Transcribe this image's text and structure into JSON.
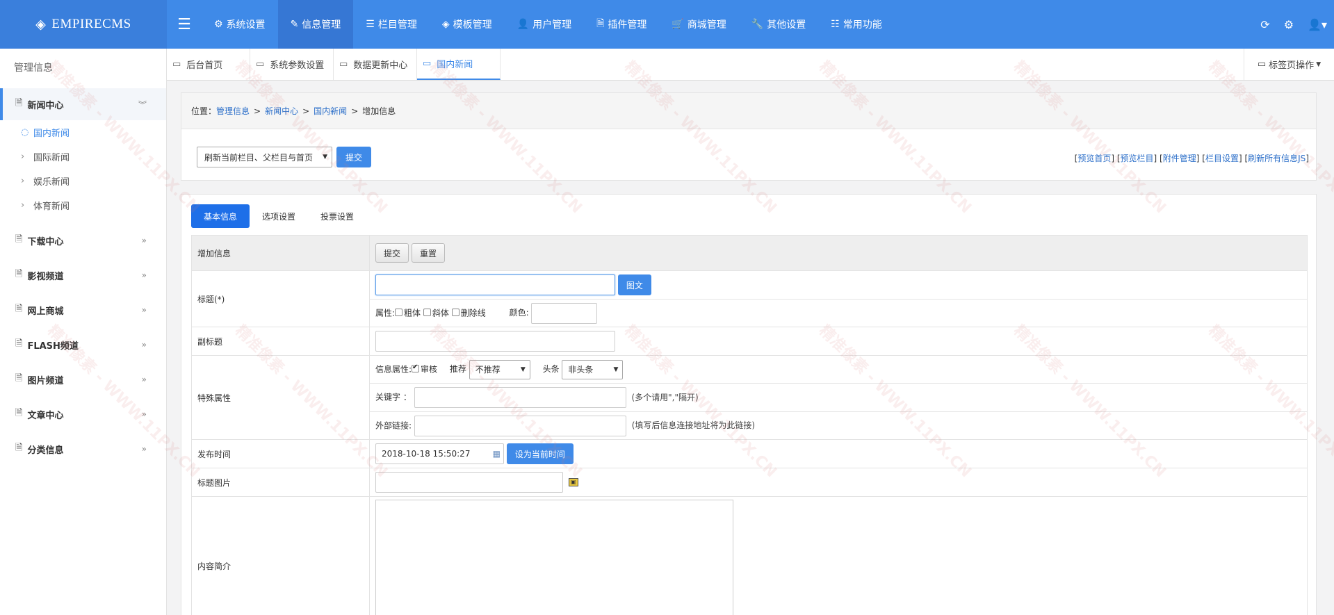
{
  "app": {
    "logo_text": "EMPIRECMS"
  },
  "topnav": [
    {
      "label": "系统设置",
      "icon": "gear-icon"
    },
    {
      "label": "信息管理",
      "icon": "edit-icon",
      "active": true
    },
    {
      "label": "栏目管理",
      "icon": "list-icon"
    },
    {
      "label": "模板管理",
      "icon": "layers-icon"
    },
    {
      "label": "用户管理",
      "icon": "user-icon"
    },
    {
      "label": "插件管理",
      "icon": "file-code-icon"
    },
    {
      "label": "商城管理",
      "icon": "cart-icon"
    },
    {
      "label": "其他设置",
      "icon": "wrench-icon"
    },
    {
      "label": "常用功能",
      "icon": "sliders-icon"
    }
  ],
  "sidebar": {
    "title": "管理信息",
    "groups": [
      {
        "label": "新闻中心",
        "open": true,
        "items": [
          {
            "label": "国内新闻",
            "active": true
          },
          {
            "label": "国际新闻"
          },
          {
            "label": "娱乐新闻"
          },
          {
            "label": "体育新闻"
          }
        ]
      },
      {
        "label": "下载中心"
      },
      {
        "label": "影视频道"
      },
      {
        "label": "网上商城"
      },
      {
        "label": "FLASH频道"
      },
      {
        "label": "图片频道"
      },
      {
        "label": "文章中心"
      },
      {
        "label": "分类信息"
      }
    ]
  },
  "pagetabs": [
    {
      "label": "后台首页"
    },
    {
      "label": "系统参数设置"
    },
    {
      "label": "数据更新中心"
    },
    {
      "label": "国内新闻",
      "active": true
    }
  ],
  "tab_ops_label": "标签页操作",
  "breadcrumb": {
    "prefix": "位置：",
    "links": [
      "管理信息",
      "新闻中心",
      "国内新闻"
    ],
    "current": "增加信息",
    "sep": ">"
  },
  "refresh": {
    "selected": "刷新当前栏目、父栏目与首页",
    "submit": "提交"
  },
  "quicklinks": [
    "预览首页",
    "预览栏目",
    "附件管理",
    "栏目设置",
    "刷新所有信息JS"
  ],
  "formtabs": [
    {
      "label": "基本信息",
      "active": true
    },
    {
      "label": "选项设置"
    },
    {
      "label": "投票设置"
    }
  ],
  "form": {
    "header_label": "增加信息",
    "submit": "提交",
    "reset": "重置",
    "title_label": "标题(*)",
    "title_btn": "图文",
    "attr_label": "属性:",
    "attr_bold": "粗体",
    "attr_italic": "斜体",
    "attr_strike": "删除线",
    "color_label": "颜色:",
    "subtitle_label": "副标题",
    "special_label": "特殊属性",
    "info_attr_label": "信息属性:",
    "review_label": "审核",
    "recommend_label": "推荐",
    "recommend_value": "不推荐",
    "headline_label": "头条",
    "headline_value": "非头条",
    "keyword_label": "关键字 ：",
    "keyword_hint": "(多个请用\",\"隔开)",
    "extlink_label": "外部链接:",
    "extlink_hint": "(填写后信息连接地址将为此链接)",
    "pubtime_label": "发布时间",
    "pubtime_value": "2018-10-18 15:50:27",
    "pubtime_btn": "设为当前时间",
    "titlepic_label": "标题图片",
    "summary_label": "内容简介"
  },
  "watermark_text": "精准像素 - WWW.11PX.CN"
}
